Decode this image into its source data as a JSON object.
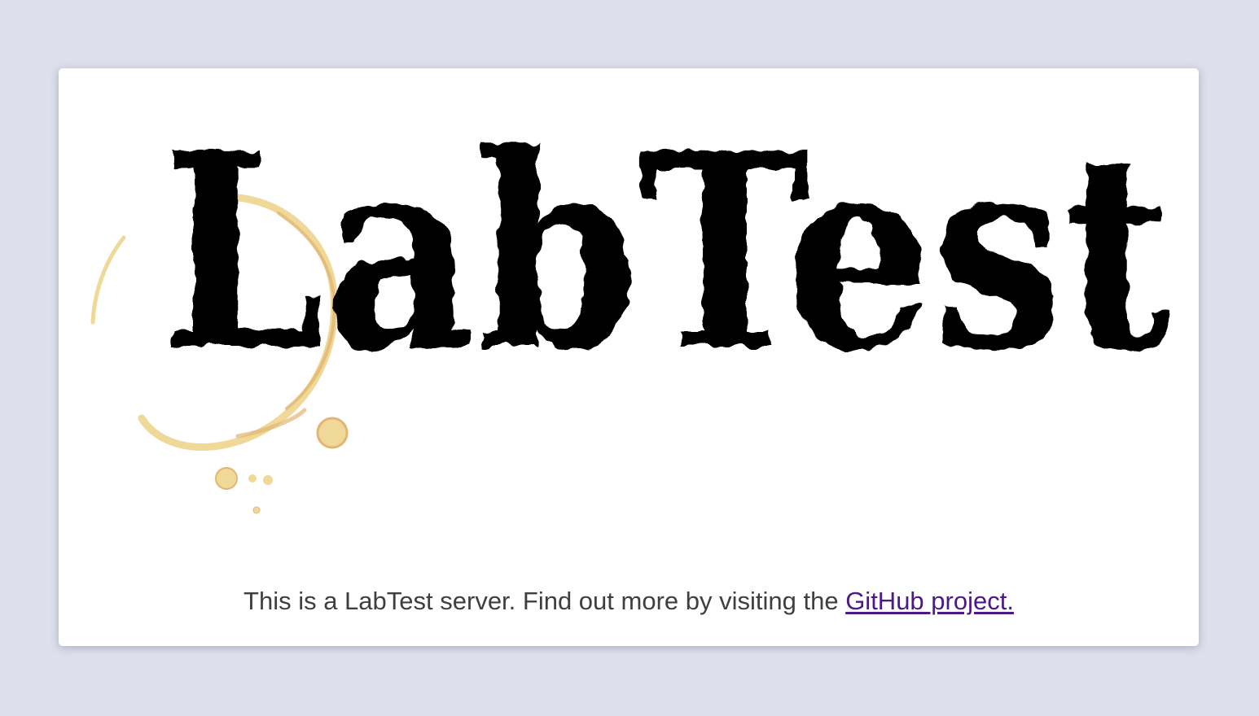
{
  "logo": {
    "text": "LabTest",
    "stain_color": "#f0d898",
    "stain_edge_color": "#e2b673"
  },
  "intro": {
    "text_before": "This is a LabTest server. Find out more by visiting the ",
    "link_label": "GitHub project.",
    "link_color": "#4b1a86",
    "text_color": "#3f3f3f"
  },
  "colors": {
    "page_background": "#dddfec",
    "card_background": "#ffffff",
    "logo_text": "#000000"
  }
}
